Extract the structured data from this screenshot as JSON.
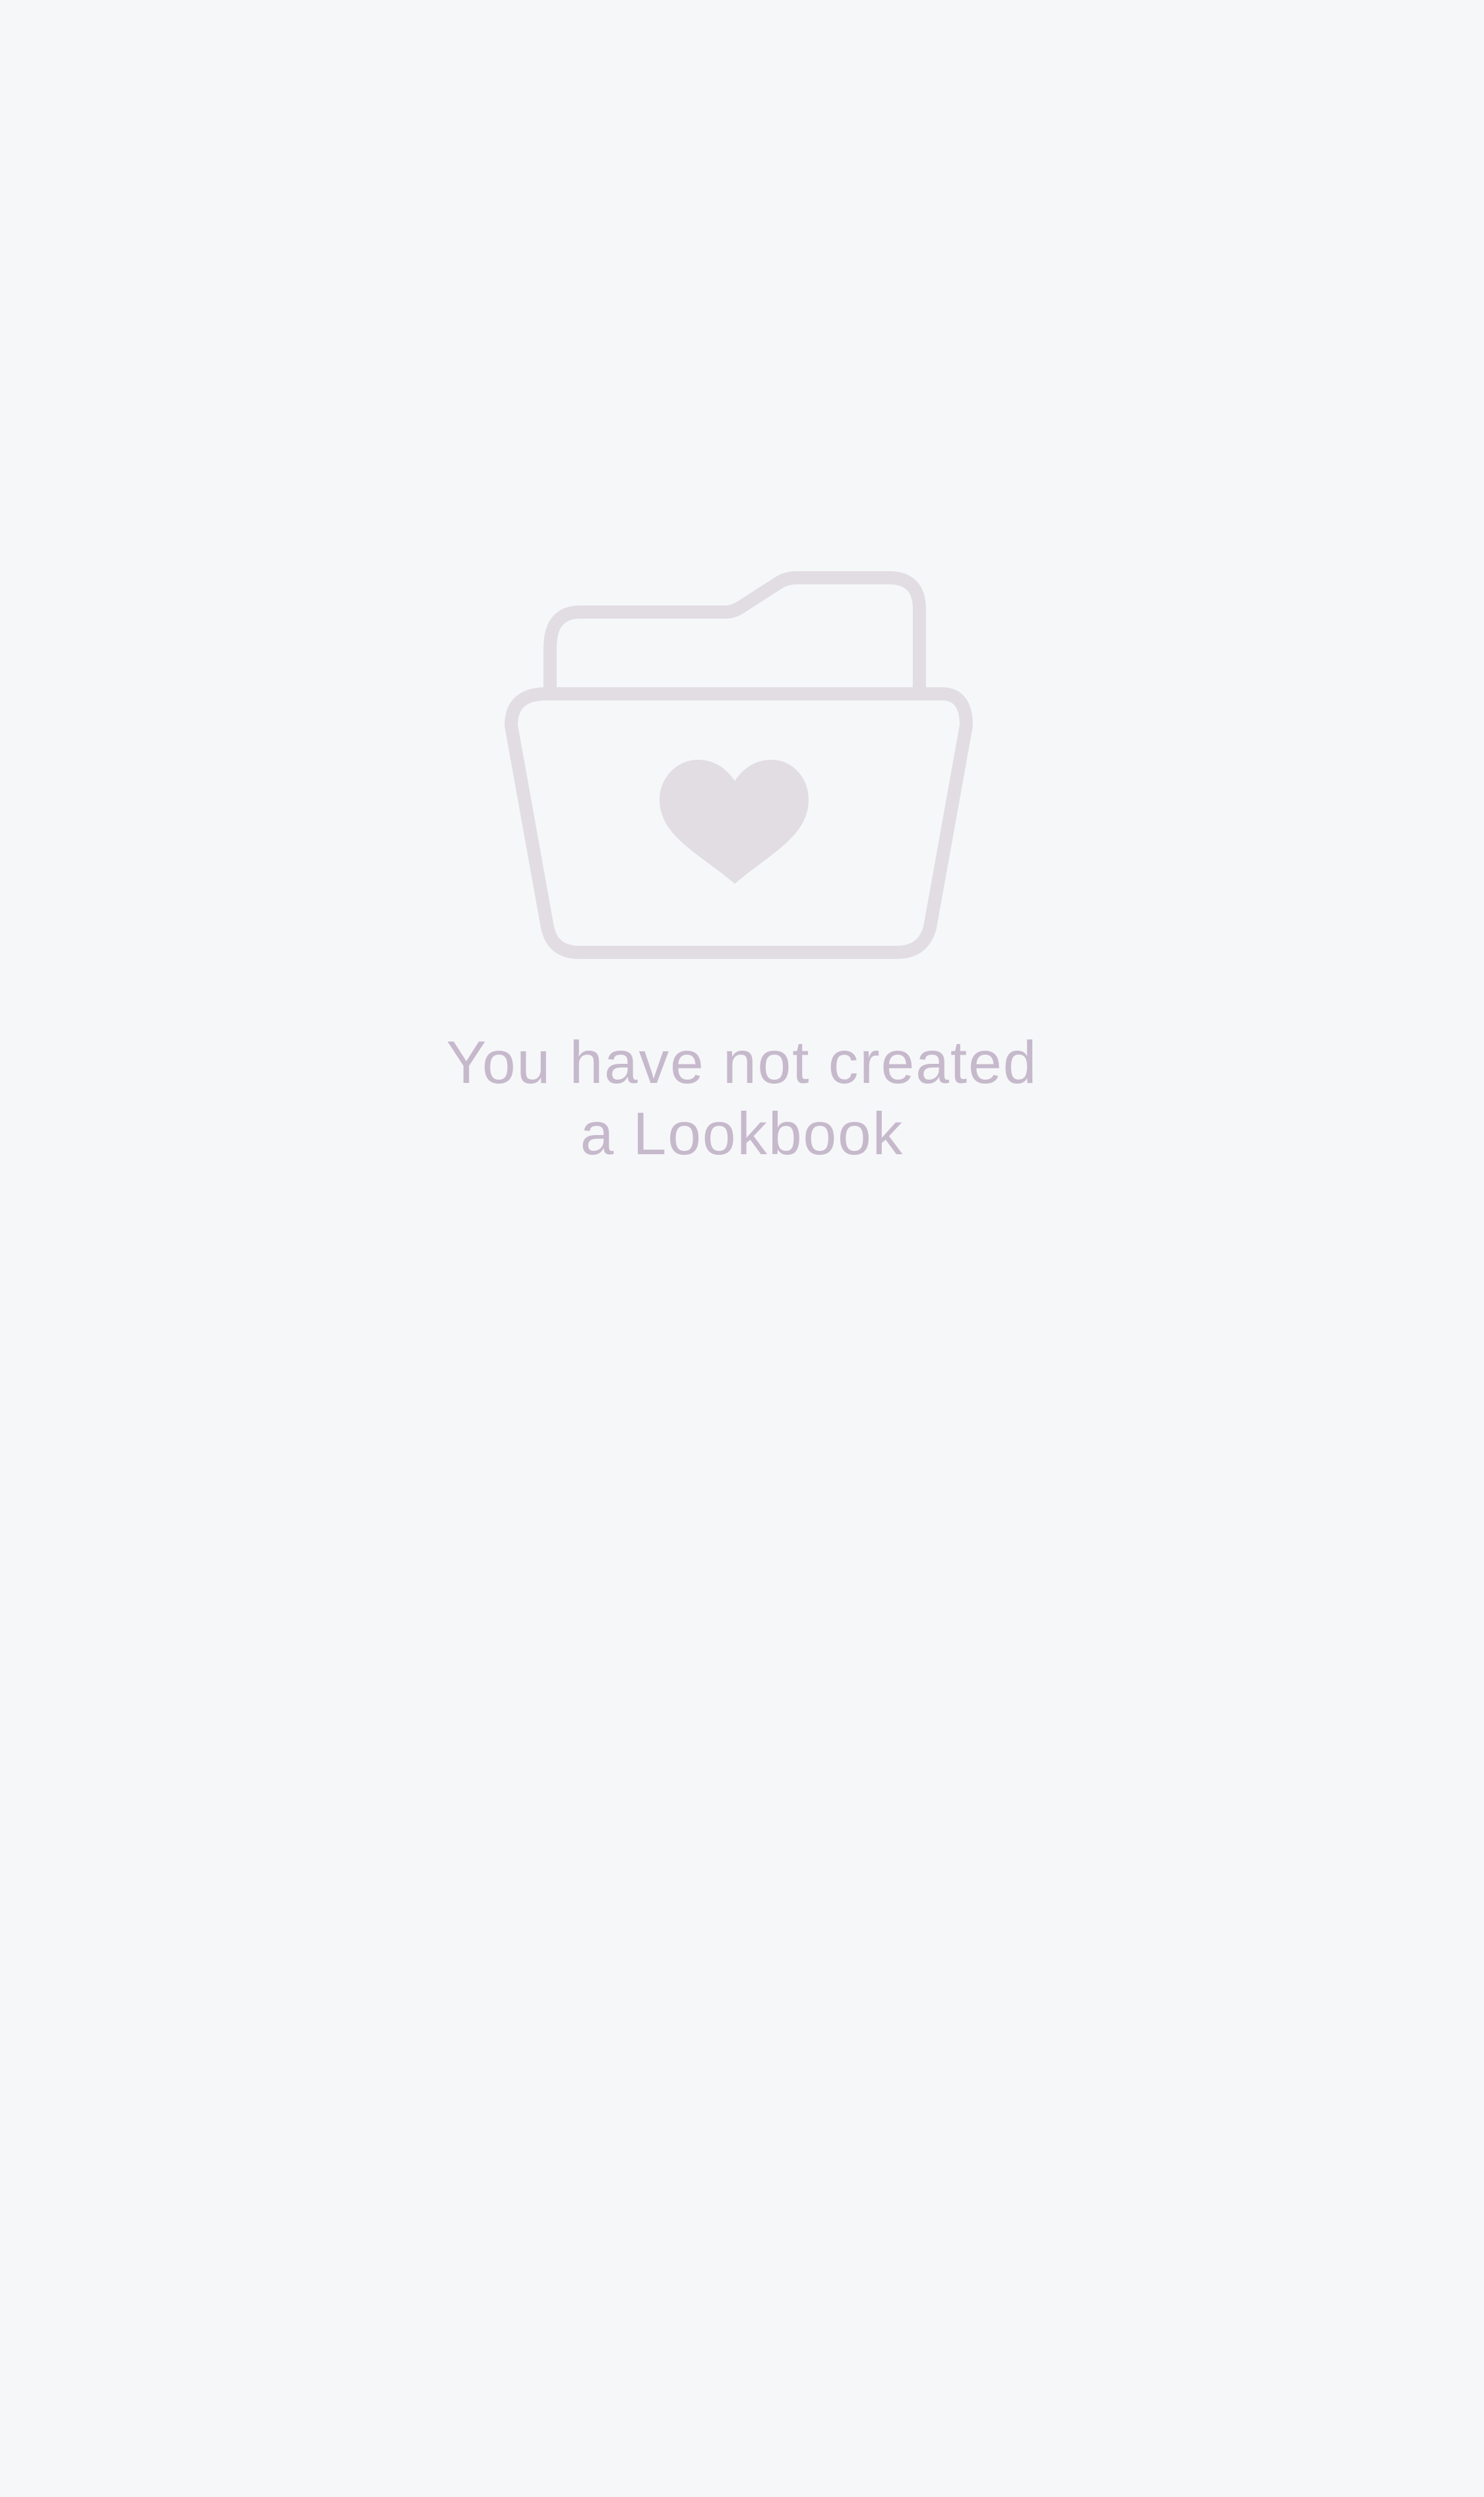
{
  "empty_state": {
    "illustration_icon": "folder-heart-icon",
    "message_line1": "You have not created",
    "message_line2": "a Lookbook",
    "colors": {
      "background": "#f6f7f9",
      "icon": "#e2dde3",
      "text": "#c6b9cc"
    }
  }
}
